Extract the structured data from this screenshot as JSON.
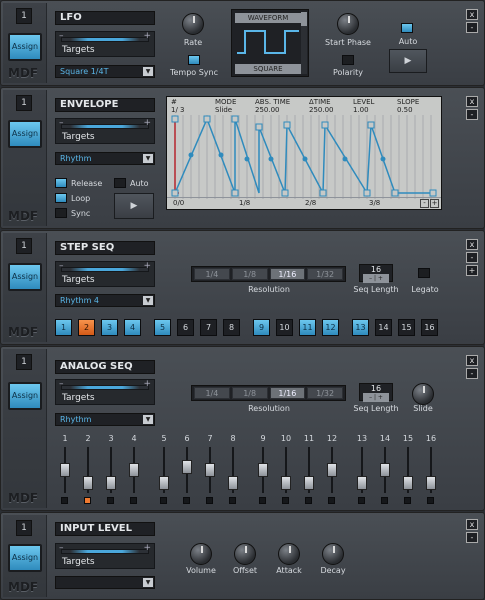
{
  "panels": {
    "lfo": {
      "number": "1",
      "assign": "Assign",
      "mdf": "MDF",
      "title": "LFO",
      "targets": "Targets",
      "dropdown": "Square 1/4T",
      "rate": "Rate",
      "tempo_sync": "Tempo Sync",
      "tempo_sync_on": true,
      "wave_header": "WAVEFORM",
      "wave_name": "SQUARE",
      "start_phase": "Start Phase",
      "polarity": "Polarity",
      "auto": "Auto",
      "auto_on": true,
      "play_icon": "play-icon",
      "close": "x",
      "minimize": "-"
    },
    "envelope": {
      "number": "1",
      "assign": "Assign",
      "mdf": "MDF",
      "title": "ENVELOPE",
      "targets": "Targets",
      "dropdown": "Rhythm",
      "release": "Release",
      "loop": "Loop",
      "sync": "Sync",
      "auto": "Auto",
      "release_on": true,
      "loop_on": true,
      "sync_on": false,
      "auto_on": false,
      "display": {
        "h_hash": "#",
        "h_mode": "MODE",
        "h_abs": "ABS. TIME",
        "h_dtime": "ΔTIME",
        "h_level": "LEVEL",
        "h_slope": "SLOPE",
        "v_hash": "1/ 3",
        "v_mode": "Slide",
        "v_abs": "250.00",
        "v_dtime": "250.00",
        "v_level": "1.00",
        "v_slope": "0.50",
        "ruler": [
          "0/0",
          "1/8",
          "2/8",
          "3/8"
        ],
        "zoom_minus": "-",
        "zoom_plus": "+"
      },
      "close": "x",
      "minimize": "-"
    },
    "stepseq": {
      "number": "1",
      "assign": "Assign",
      "mdf": "MDF",
      "title": "STEP SEQ",
      "targets": "Targets",
      "dropdown": "Rhythm 4",
      "resolutions": [
        "1/4",
        "1/8",
        "1/16",
        "1/32"
      ],
      "selected_resolution": "1/16",
      "resolution_label": "Resolution",
      "seq_length": "16",
      "seq_length_label": "Seq Length",
      "legato": "Legato",
      "steps": [
        "1",
        "2",
        "3",
        "4",
        "5",
        "6",
        "7",
        "8",
        "9",
        "10",
        "11",
        "12",
        "13",
        "14",
        "15",
        "16"
      ],
      "step_states": [
        "blue",
        "orange",
        "blue",
        "blue",
        "blue",
        "off",
        "off",
        "off",
        "blue",
        "off",
        "blue",
        "blue",
        "blue",
        "off",
        "off",
        "off"
      ],
      "close": "x",
      "minimize": "-",
      "plus": "+"
    },
    "analogseq": {
      "number": "1",
      "assign": "Assign",
      "mdf": "MDF",
      "title": "ANALOG SEQ",
      "targets": "Targets",
      "dropdown": "Rhythm",
      "resolutions": [
        "1/4",
        "1/8",
        "1/16",
        "1/32"
      ],
      "selected_resolution": "1/16",
      "resolution_label": "Resolution",
      "seq_length": "16",
      "seq_length_label": "Seq Length",
      "slide": "Slide",
      "columns": [
        "1",
        "2",
        "3",
        "4",
        "5",
        "6",
        "7",
        "8",
        "9",
        "10",
        "11",
        "12",
        "13",
        "14",
        "15",
        "16"
      ],
      "fader_levels": [
        0.5,
        0.1,
        0.1,
        0.5,
        0.1,
        0.6,
        0.5,
        0.1,
        0.5,
        0.1,
        0.1,
        0.5,
        0.1,
        0.5,
        0.1,
        0.1
      ],
      "active_step": "2",
      "close": "x",
      "minimize": "-"
    },
    "inputlevel": {
      "number": "1",
      "assign": "Assign",
      "mdf": "MDF",
      "title": "INPUT LEVEL",
      "targets": "Targets",
      "dropdown": "",
      "volume": "Volume",
      "offset": "Offset",
      "attack": "Attack",
      "decay": "Decay",
      "close": "x",
      "minimize": "-"
    }
  },
  "colors": {
    "accent": "#4aa7db",
    "active_step": "#e8701f",
    "panel": "#43484e",
    "display": "#c7c9c7"
  }
}
